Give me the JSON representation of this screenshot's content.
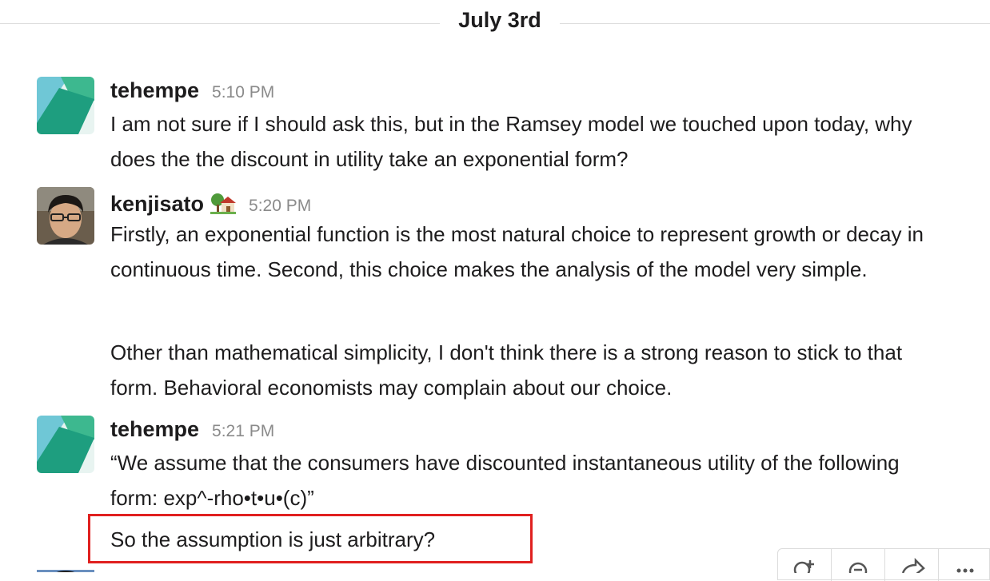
{
  "day_divider": {
    "label": "July 3rd"
  },
  "messages": [
    {
      "sender": "tehempe",
      "time": "5:10 PM",
      "avatar_icon": "green-geometric-avatar-icon",
      "text": [
        "I am not sure if I should ask this, but in the Ramsey model we touched upon today, why does the the discount in utility take an exponential form?"
      ]
    },
    {
      "sender": "kenjisato",
      "status_icon": "house-with-garden-emoji",
      "time": "5:20 PM",
      "avatar_icon": "profile-photo-avatar",
      "text": [
        "Firstly, an exponential function is the most natural choice to represent growth or decay in continuous time. Second, this choice makes the analysis of the model very simple.",
        "Other than mathematical simplicity, I don't think there is a strong reason to stick to that form. Behavioral economists may complain about our choice."
      ]
    },
    {
      "sender": "tehempe",
      "time": "5:21 PM",
      "avatar_icon": "green-geometric-avatar-icon",
      "text": [
        "“We assume that the consumers have discounted instantaneous utility of the following form: exp^-rho•t•u•(c)”",
        "So the assumption is just arbitrary?"
      ]
    }
  ],
  "hover_actions": [
    "add-reaction-icon",
    "reply-thread-icon",
    "share-message-icon",
    "more-actions-icon"
  ],
  "colors": {
    "highlight": "#e0201f",
    "avatar_teal": "#1e9e7f",
    "avatar_green": "#3db88f",
    "avatar_blue": "#6fc7d6"
  }
}
